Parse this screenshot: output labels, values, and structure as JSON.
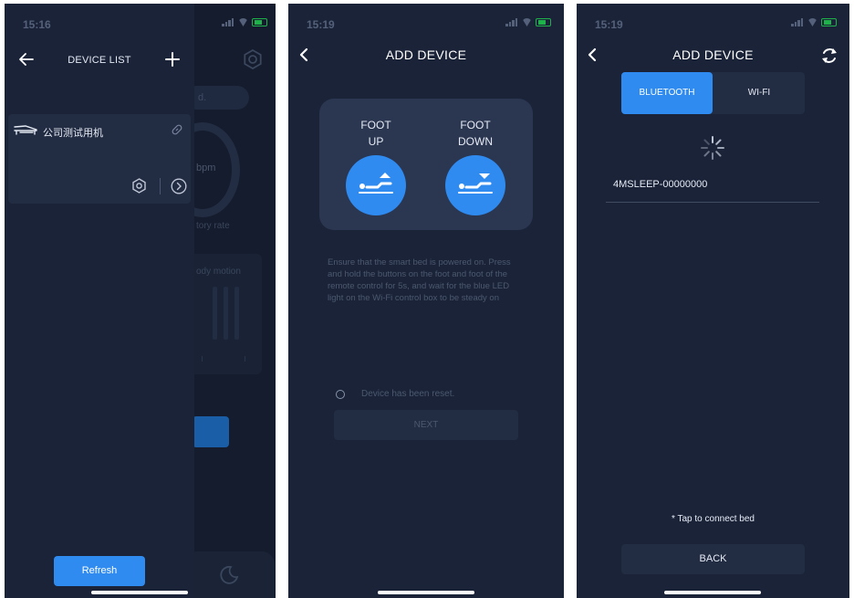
{
  "screen1": {
    "status": {
      "time": "15:16"
    },
    "title": "DEVICE LIST",
    "device": {
      "name": "公司测试用机"
    },
    "refresh_label": "Refresh",
    "background": {
      "pill_text": "d.",
      "unit": "bpm",
      "respiratory": "tory rate",
      "motion": "ody motion"
    }
  },
  "screen2": {
    "status": {
      "time": "15:19"
    },
    "title": "ADD DEVICE",
    "foot_up_line1": "FOOT",
    "foot_up_line2": "UP",
    "foot_down_line1": "FOOT",
    "foot_down_line2": "DOWN",
    "instructions": "Ensure that the smart bed is powered on. Press and hold the buttons on the foot and foot of the remote control for 5s, and wait for the blue LED light on the Wi-Fi control box to be steady on",
    "reset_label": "Device has been reset.",
    "next_label": "NEXT"
  },
  "screen3": {
    "status": {
      "time": "15:19"
    },
    "title": "ADD DEVICE",
    "tab_bluetooth": "BLUETOOTH",
    "tab_wifi": "WI-FI",
    "device_name": "4MSLEEP-00000000",
    "hint": "* Tap to connect bed",
    "back_label": "BACK"
  },
  "colors": {
    "accent": "#2f8bf0",
    "background": "#1a2338",
    "card": "#222c42"
  }
}
